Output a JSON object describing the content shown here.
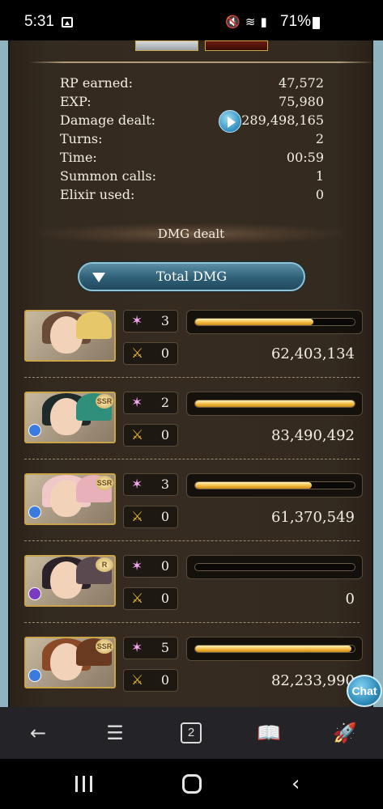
{
  "status_bar": {
    "time": "5:31",
    "battery": "71%"
  },
  "stats": [
    {
      "label": "RP earned:",
      "value": "47,572"
    },
    {
      "label": "EXP:",
      "value": "75,980"
    },
    {
      "label": "Damage dealt:",
      "value": "289,498,165"
    },
    {
      "label": "Turns:",
      "value": "2"
    },
    {
      "label": "Time:",
      "value": "00:59"
    },
    {
      "label": "Summon calls:",
      "value": "1"
    },
    {
      "label": "Elixir used:",
      "value": "0"
    }
  ],
  "dmg_section": {
    "title": "DMG dealt",
    "filter_button": "Total DMG"
  },
  "characters": [
    {
      "rarity": "",
      "ougi": "3",
      "chain": "0",
      "damage": "62,403,134",
      "fill": 0.74,
      "element_color": ""
    },
    {
      "rarity": "SSR",
      "ougi": "2",
      "chain": "0",
      "damage": "83,490,492",
      "fill": 1.0,
      "element_color": "#3a7be0"
    },
    {
      "rarity": "SSR",
      "ougi": "3",
      "chain": "0",
      "damage": "61,370,549",
      "fill": 0.73,
      "element_color": "#3a7be0"
    },
    {
      "rarity": "R",
      "ougi": "0",
      "chain": "0",
      "damage": "0",
      "fill": 0.0,
      "element_color": "#7a3ac0"
    },
    {
      "rarity": "SSR",
      "ougi": "5",
      "chain": "0",
      "damage": "82,233,990",
      "fill": 0.98,
      "element_color": "#3a7be0"
    }
  ],
  "chat": {
    "label": "Chat"
  },
  "browser_toolbar": {
    "tab_count": "2"
  },
  "icons": {
    "back": "arrow-left-icon",
    "menu": "hamburger-icon",
    "tabs": "tabs-icon",
    "bookmarks": "book-icon",
    "rocket": "rocket-icon"
  }
}
